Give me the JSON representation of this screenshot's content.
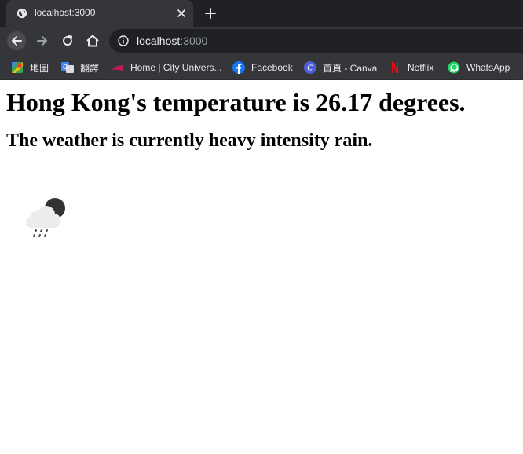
{
  "browser": {
    "tab": {
      "title": "localhost:3000",
      "favicon": "globe-icon"
    },
    "address_bar": {
      "host": "localhost",
      "port": ":3000"
    },
    "bookmarks": [
      {
        "label": "地圖",
        "icon": "maps-icon"
      },
      {
        "label": "翻譯",
        "icon": "translate-icon"
      },
      {
        "label": "Home | City Univers...",
        "icon": "cityu-icon"
      },
      {
        "label": "Facebook",
        "icon": "facebook-icon"
      },
      {
        "label": "首頁 - Canva",
        "icon": "canva-icon"
      },
      {
        "label": "Netflix",
        "icon": "netflix-icon"
      },
      {
        "label": "WhatsApp",
        "icon": "whatsapp-icon"
      }
    ]
  },
  "page": {
    "heading": "Hong Kong's temperature is 26.17 degrees.",
    "subheading": "The weather is currently heavy intensity rain.",
    "weather_icon": "rain-cloud-moon-icon"
  }
}
